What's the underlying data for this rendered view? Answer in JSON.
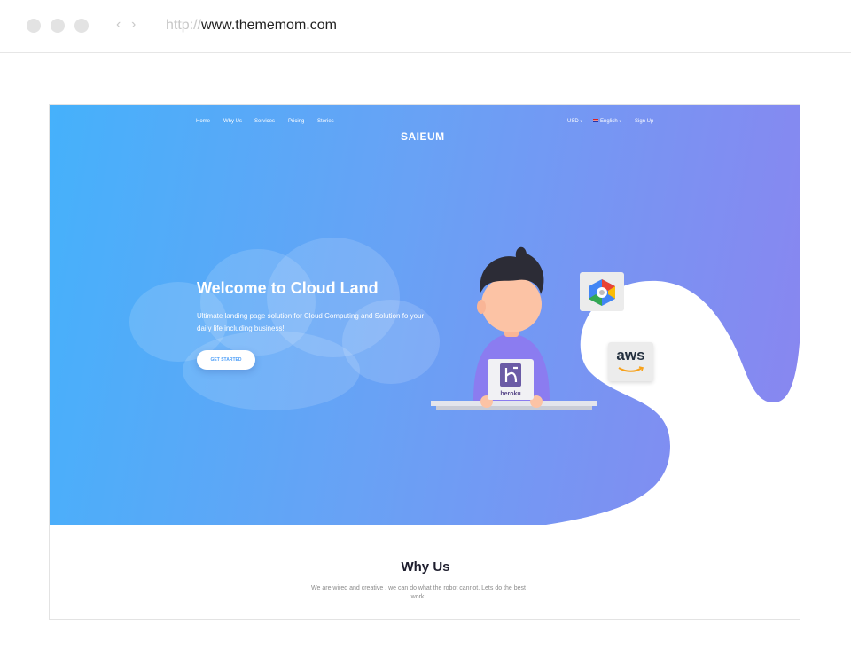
{
  "browser": {
    "url_protocol": "http://",
    "url_host": "www.thememom.com",
    "back_icon": "chevron-left-icon",
    "forward_icon": "chevron-right-icon"
  },
  "nav": {
    "items": [
      "Home",
      "Why Us",
      "Services",
      "Pricing",
      "Stories"
    ],
    "logo": "SAIEUM",
    "currency": "USD",
    "language": "English",
    "signup": "Sign Up"
  },
  "hero": {
    "title": "Welcome to  Cloud Land",
    "subtitle": "Ultimate landing page solution for Cloud Computing and Solution fo your daily life including business!",
    "cta": "GET STARTED",
    "aws_logo_text": "aws",
    "heroku_logo_text": "heroku"
  },
  "why": {
    "title": "Why Us",
    "subtitle": "We are wired and creative , we can do what the robot cannot. Lets do the best work!"
  },
  "colors": {
    "gradient_start": "#45b1fb",
    "gradient_end": "#8a85f0",
    "blob": "#8a83ef",
    "cta_text": "#4e9ff8"
  }
}
